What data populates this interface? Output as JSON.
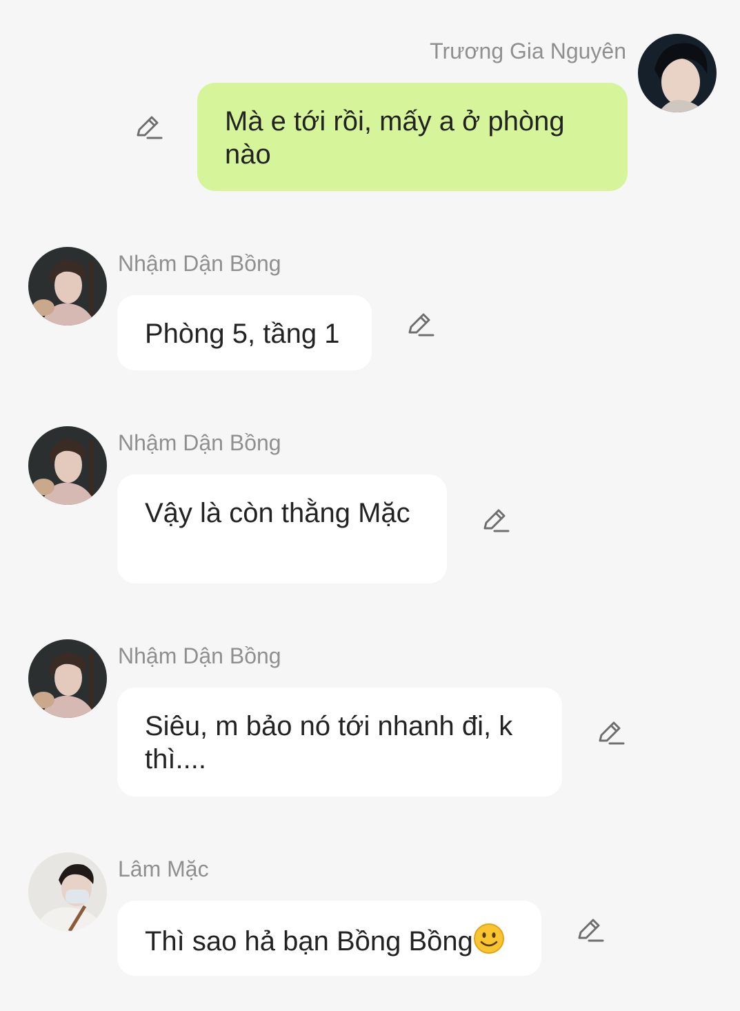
{
  "messages": [
    {
      "sender": "Trương Gia Nguyên",
      "text": "Mà e tới rồi, mấy a ở phòng nào",
      "side": "right",
      "avatar_icon": "avatar-photo-icon"
    },
    {
      "sender": "Nhậm Dận Bồng",
      "text": "Phòng 5, tầng 1",
      "side": "left",
      "avatar_icon": "avatar-photo-icon"
    },
    {
      "sender": "Nhậm Dận Bồng",
      "text": "Vậy là còn thằng Mặc",
      "side": "left",
      "avatar_icon": "avatar-photo-icon"
    },
    {
      "sender": "Nhậm Dận Bồng",
      "text": "Siêu, m bảo nó tới nhanh đi, k thì....",
      "side": "left",
      "avatar_icon": "avatar-photo-icon"
    },
    {
      "sender": "Lâm Mặc",
      "text": "Thì sao hả bạn Bồng Bồng",
      "emoji": "slightly-smiling-face-icon",
      "side": "left",
      "avatar_icon": "avatar-photo-icon"
    }
  ],
  "colors": {
    "background": "#f6f6f6",
    "own_bubble": "#d6f59a",
    "other_bubble": "#ffffff",
    "sender_name": "#8f8f8f",
    "message_text": "#222222",
    "edit_icon": "#6e6e6e"
  },
  "icons": {
    "edit": "pencil-edit-icon"
  }
}
